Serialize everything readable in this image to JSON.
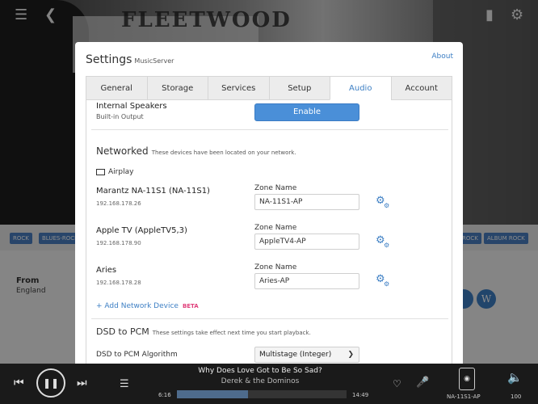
{
  "background": {
    "band_name_sign": "FLEETWOOD",
    "tags": [
      "ROCK",
      "BLUES-ROCK",
      "ROCK",
      "ALBUM ROCK"
    ],
    "from_label": "From",
    "from_value": "England",
    "circle_button_wiki": "W"
  },
  "dialog": {
    "title": "Settings",
    "subtitle": "MusicServer",
    "about_link": "About",
    "tabs": [
      {
        "label": "General",
        "active": false
      },
      {
        "label": "Storage",
        "active": false
      },
      {
        "label": "Services",
        "active": false
      },
      {
        "label": "Setup",
        "active": false
      },
      {
        "label": "Audio",
        "active": true
      },
      {
        "label": "Account",
        "active": false
      }
    ],
    "internal_speakers": {
      "title": "Internal Speakers",
      "subtitle": "Built-in Output",
      "button_label": "Enable"
    },
    "networked": {
      "heading": "Networked",
      "note": "These devices have been located on your network.",
      "group_label": "Airplay",
      "zone_name_label": "Zone Name",
      "devices": [
        {
          "name": "Marantz NA-11S1 (NA-11S1)",
          "ip": "192.168.178.26",
          "zone": "NA-11S1-AP"
        },
        {
          "name": "Apple TV (AppleTV5,3)",
          "ip": "192.168.178.90",
          "zone": "AppleTV4-AP"
        },
        {
          "name": "Aries",
          "ip": "192.168.178.28",
          "zone": "Aries-AP"
        }
      ],
      "add_device_label": "Add Network Device",
      "beta_badge": "BETA"
    },
    "dsd": {
      "heading": "DSD to PCM",
      "note": "These settings take effect next time you start playback.",
      "algorithm_label": "DSD to PCM Algorithm",
      "algorithm_value": "Multistage (Integer)"
    }
  },
  "player": {
    "track_title": "Why Does Love Got to Be So Sad?",
    "artist": "Derek & the Dominos",
    "elapsed": "6:16",
    "duration": "14:49",
    "progress": 0.42,
    "zone_name": "NA-11S1-AP",
    "volume": "100"
  },
  "colors": {
    "accent": "#3d7fc4",
    "enable_button": "#4a8fd8",
    "beta": "#e0407b",
    "player_bg": "#1a1a1a"
  }
}
